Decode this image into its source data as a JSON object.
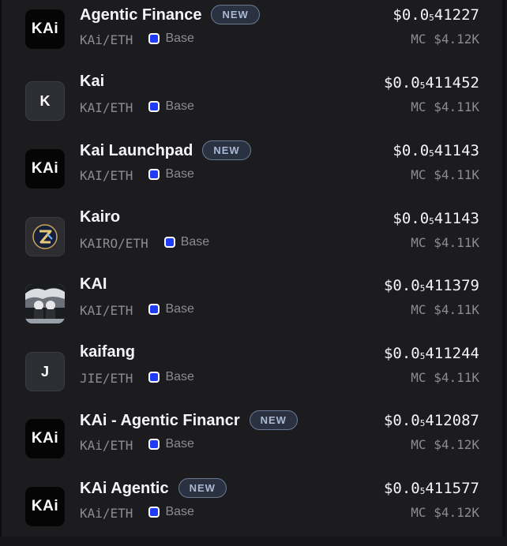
{
  "tokens": [
    {
      "name": "Agentic Finance",
      "new": "NEW",
      "pair": "KAi/ETH",
      "chain": "Base",
      "price_pre": "$0.0",
      "price_sub": "5",
      "price_post": "41227",
      "mc": "MC $4.12K",
      "thumb": "kai-logo",
      "logo_text": "KAi"
    },
    {
      "name": "Kai",
      "new": "",
      "pair": "KAI/ETH",
      "chain": "Base",
      "price_pre": "$0.0",
      "price_sub": "5",
      "price_post": "411452",
      "mc": "MC $4.11K",
      "thumb": "letter",
      "letter": "K"
    },
    {
      "name": "Kai Launchpad",
      "new": "NEW",
      "pair": "KAI/ETH",
      "chain": "Base",
      "price_pre": "$0.0",
      "price_sub": "5",
      "price_post": "41143",
      "mc": "MC $4.11K",
      "thumb": "kai-logo",
      "logo_text": "KAi"
    },
    {
      "name": "Kairo",
      "new": "",
      "pair": "KAIRO/ETH",
      "chain": "Base",
      "price_pre": "$0.0",
      "price_sub": "5",
      "price_post": "41143",
      "mc": "MC $4.11K",
      "thumb": "kairo-logo"
    },
    {
      "name": "KAI",
      "new": "",
      "pair": "KAI/ETH",
      "chain": "Base",
      "price_pre": "$0.0",
      "price_sub": "5",
      "price_post": "411379",
      "mc": "MC $4.11K",
      "thumb": "photo"
    },
    {
      "name": "kaifang",
      "new": "",
      "pair": "JIE/ETH",
      "chain": "Base",
      "price_pre": "$0.0",
      "price_sub": "5",
      "price_post": "411244",
      "mc": "MC $4.11K",
      "thumb": "letter",
      "letter": "J"
    },
    {
      "name": "KAi - Agentic Financr",
      "new": "NEW",
      "pair": "KAi/ETH",
      "chain": "Base",
      "price_pre": "$0.0",
      "price_sub": "5",
      "price_post": "412087",
      "mc": "MC $4.12K",
      "thumb": "kai-logo",
      "logo_text": "KAi"
    },
    {
      "name": "KAi Agentic",
      "new": "NEW",
      "pair": "KAi/ETH",
      "chain": "Base",
      "price_pre": "$0.0",
      "price_sub": "5",
      "price_post": "411577",
      "mc": "MC $4.12K",
      "thumb": "kai-logo",
      "logo_text": "KAi"
    }
  ],
  "colors": {
    "chain_icon": "#1e3bf5",
    "badge_text": "#a9b9d6",
    "muted": "#8b8b93"
  }
}
